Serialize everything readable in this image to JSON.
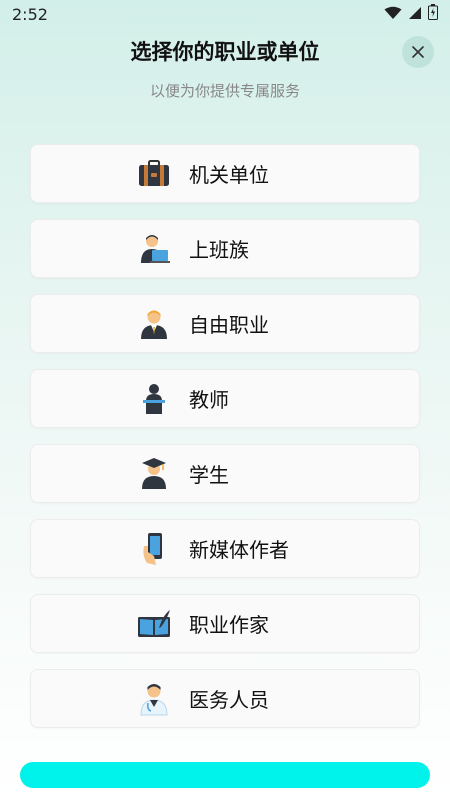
{
  "status_bar": {
    "time": "2:52"
  },
  "header": {
    "title": "选择你的职业或单位",
    "subtitle": "以便为你提供专属服务"
  },
  "occupations": [
    {
      "label": "机关单位",
      "icon": "briefcase-icon"
    },
    {
      "label": "上班族",
      "icon": "office-worker-icon"
    },
    {
      "label": "自由职业",
      "icon": "freelancer-icon"
    },
    {
      "label": "教师",
      "icon": "teacher-podium-icon"
    },
    {
      "label": "学生",
      "icon": "graduate-cap-icon"
    },
    {
      "label": "新媒体作者",
      "icon": "smartphone-hand-icon"
    },
    {
      "label": "职业作家",
      "icon": "book-quill-icon"
    },
    {
      "label": "医务人员",
      "icon": "doctor-icon"
    }
  ],
  "colors": {
    "accent": "#00f3ea",
    "close_bg": "#bfe3db",
    "bg_top": "#d3efe9"
  }
}
